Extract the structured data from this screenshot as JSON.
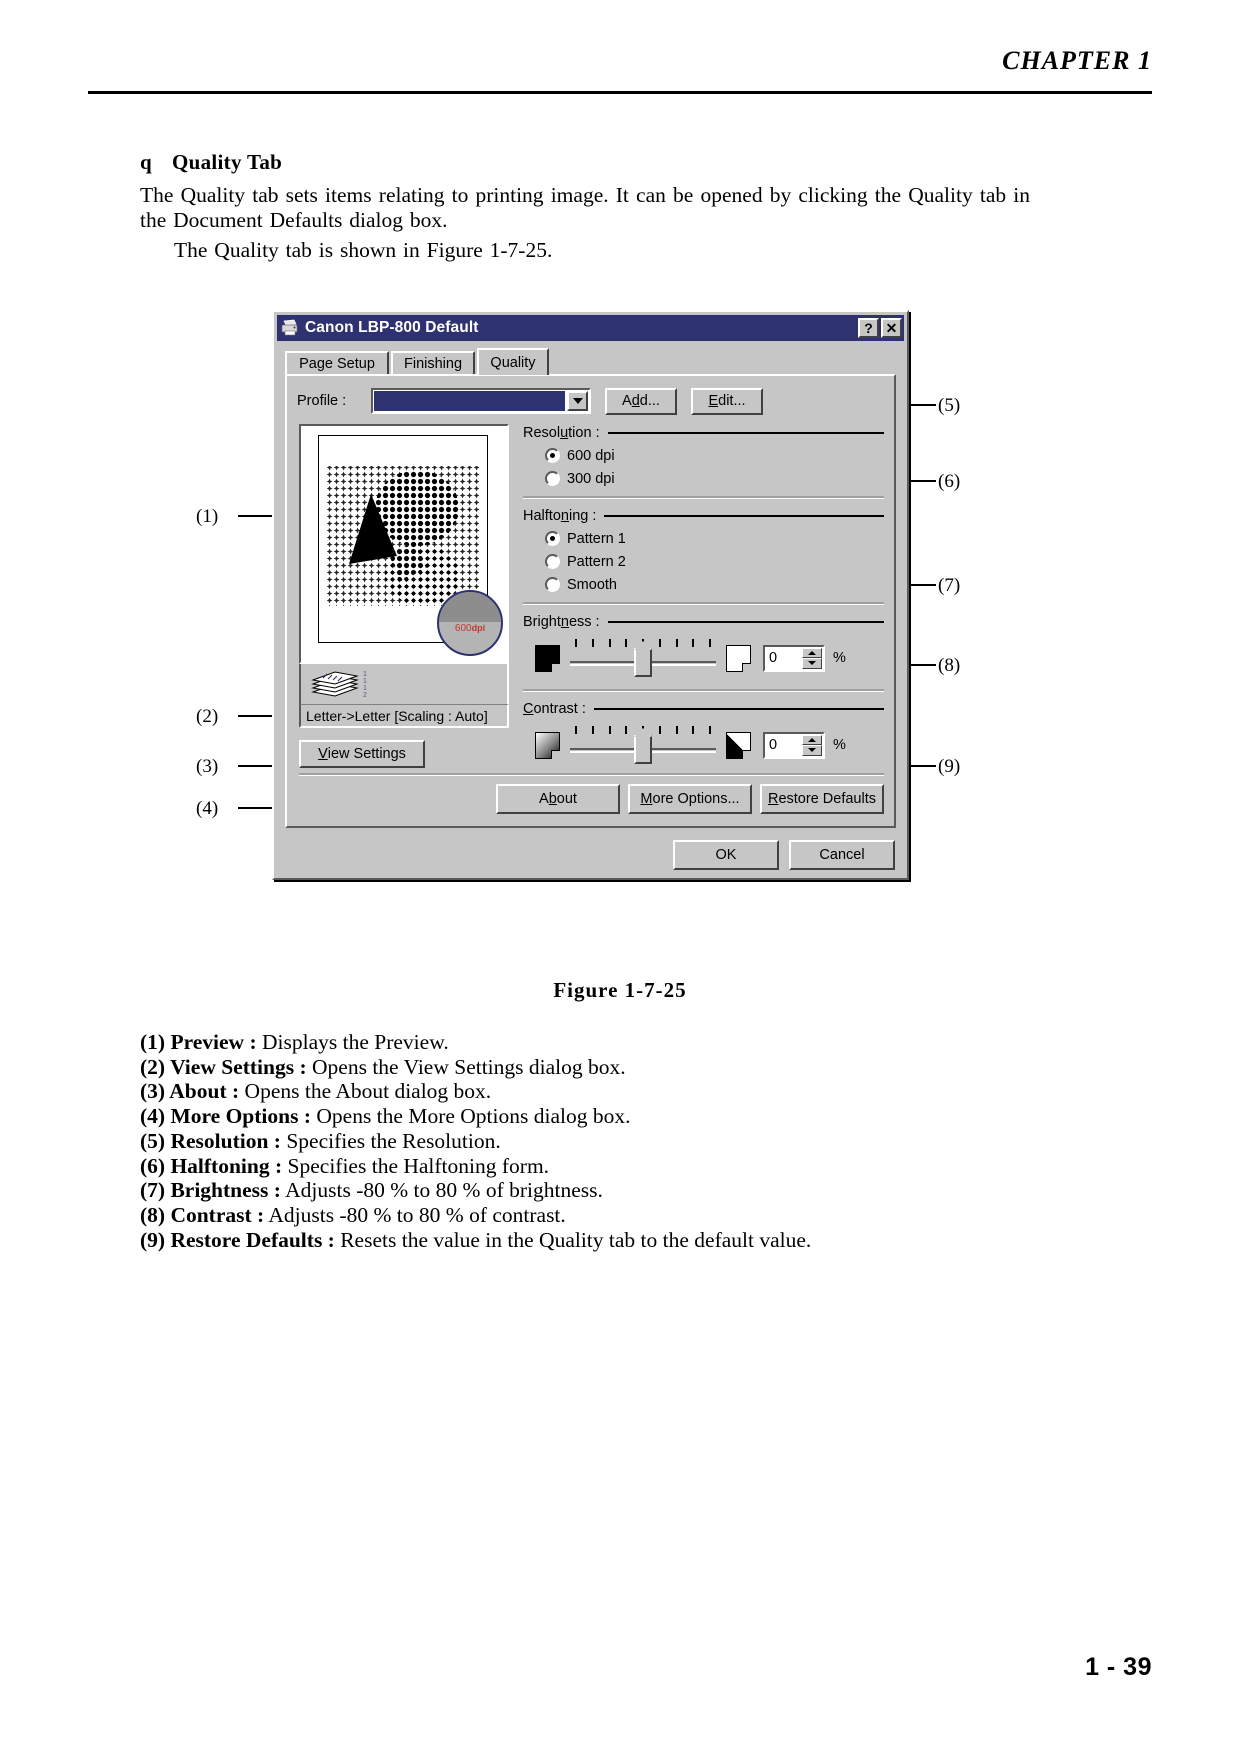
{
  "header": {
    "chapter": "CHAPTER 1"
  },
  "body": {
    "bullet": "q",
    "section_title": "Quality Tab",
    "paragraph1": "The Quality tab sets items relating to printing image. It can be opened by clicking the Quality tab in the Document Defaults dialog box.",
    "paragraph2": "The Quality tab is shown in Figure 1-7-25."
  },
  "dialog": {
    "title": "Canon LBP-800 Default",
    "titlebar_icon": "printer-icon",
    "help_button": "?",
    "close_button": "✕",
    "tabs": [
      {
        "label": "Page Setup",
        "active": false
      },
      {
        "label": "Finishing",
        "active": false
      },
      {
        "label": "Quality",
        "active": true
      }
    ],
    "profile": {
      "label": "Profile :",
      "value": "",
      "add_button": "Add...",
      "add_accel": "d",
      "edit_button": "Edit...",
      "edit_accel": "E"
    },
    "preview": {
      "loupe_label": "600",
      "loupe_unit": "dpi",
      "status": "Letter->Letter [Scaling : Auto]",
      "view_settings_button": "View Settings",
      "view_settings_accel": "V"
    },
    "resolution": {
      "title": "Resolution :",
      "options": [
        {
          "label": "600 dpi",
          "selected": true
        },
        {
          "label": "300 dpi",
          "selected": false
        }
      ]
    },
    "halftoning": {
      "title": "Halftoning :",
      "options": [
        {
          "label": "Pattern 1",
          "selected": true
        },
        {
          "label": "Pattern 2",
          "selected": false
        },
        {
          "label": "Smooth",
          "selected": false
        }
      ]
    },
    "brightness": {
      "title": "Brightness :",
      "value": "0",
      "unit": "%",
      "tick_count": 9,
      "thumb_percent": 50
    },
    "contrast": {
      "title": "Contrast :",
      "value": "0",
      "unit": "%",
      "tick_count": 9,
      "thumb_percent": 50
    },
    "actions": {
      "about": "About",
      "about_accel": "b",
      "more_options": "More Options...",
      "more_options_accel": "M",
      "restore_defaults": "Restore Defaults",
      "restore_defaults_accel": "R"
    },
    "footer": {
      "ok": "OK",
      "cancel": "Cancel"
    }
  },
  "callouts": [
    {
      "id": "c1",
      "label": "(1)"
    },
    {
      "id": "c2",
      "label": "(2)"
    },
    {
      "id": "c3",
      "label": "(3)"
    },
    {
      "id": "c4",
      "label": "(4)"
    },
    {
      "id": "c5",
      "label": "(5)"
    },
    {
      "id": "c6",
      "label": "(6)"
    },
    {
      "id": "c7",
      "label": "(7)"
    },
    {
      "id": "c8",
      "label": "(8)"
    },
    {
      "id": "c9",
      "label": "(9)"
    }
  ],
  "figure_caption": "Figure 1-7-25",
  "legend": [
    {
      "num": "(1)",
      "term": "Preview :",
      "desc": "Displays the Preview."
    },
    {
      "num": "(2)",
      "term": "View Settings :",
      "desc": "Opens the View Settings dialog box."
    },
    {
      "num": "(3)",
      "term": "About :",
      "desc": "Opens the About dialog box."
    },
    {
      "num": "(4)",
      "term": "More Options :",
      "desc": "Opens the More Options dialog box."
    },
    {
      "num": "(5)",
      "term": "Resolution :",
      "desc": "Specifies the Resolution."
    },
    {
      "num": "(6)",
      "term": "Halftoning :",
      "desc": "Specifies the Halftoning form."
    },
    {
      "num": "(7)",
      "term": "Brightness :",
      "desc": "Adjusts -80 % to 80 % of brightness."
    },
    {
      "num": "(8)",
      "term": "Contrast :",
      "desc": "Adjusts -80 % to 80 % of contrast."
    },
    {
      "num": "(9)",
      "term": "Restore Defaults :",
      "desc": "Resets the value in the Quality tab to the default value."
    }
  ],
  "page_number": "1 - 39"
}
